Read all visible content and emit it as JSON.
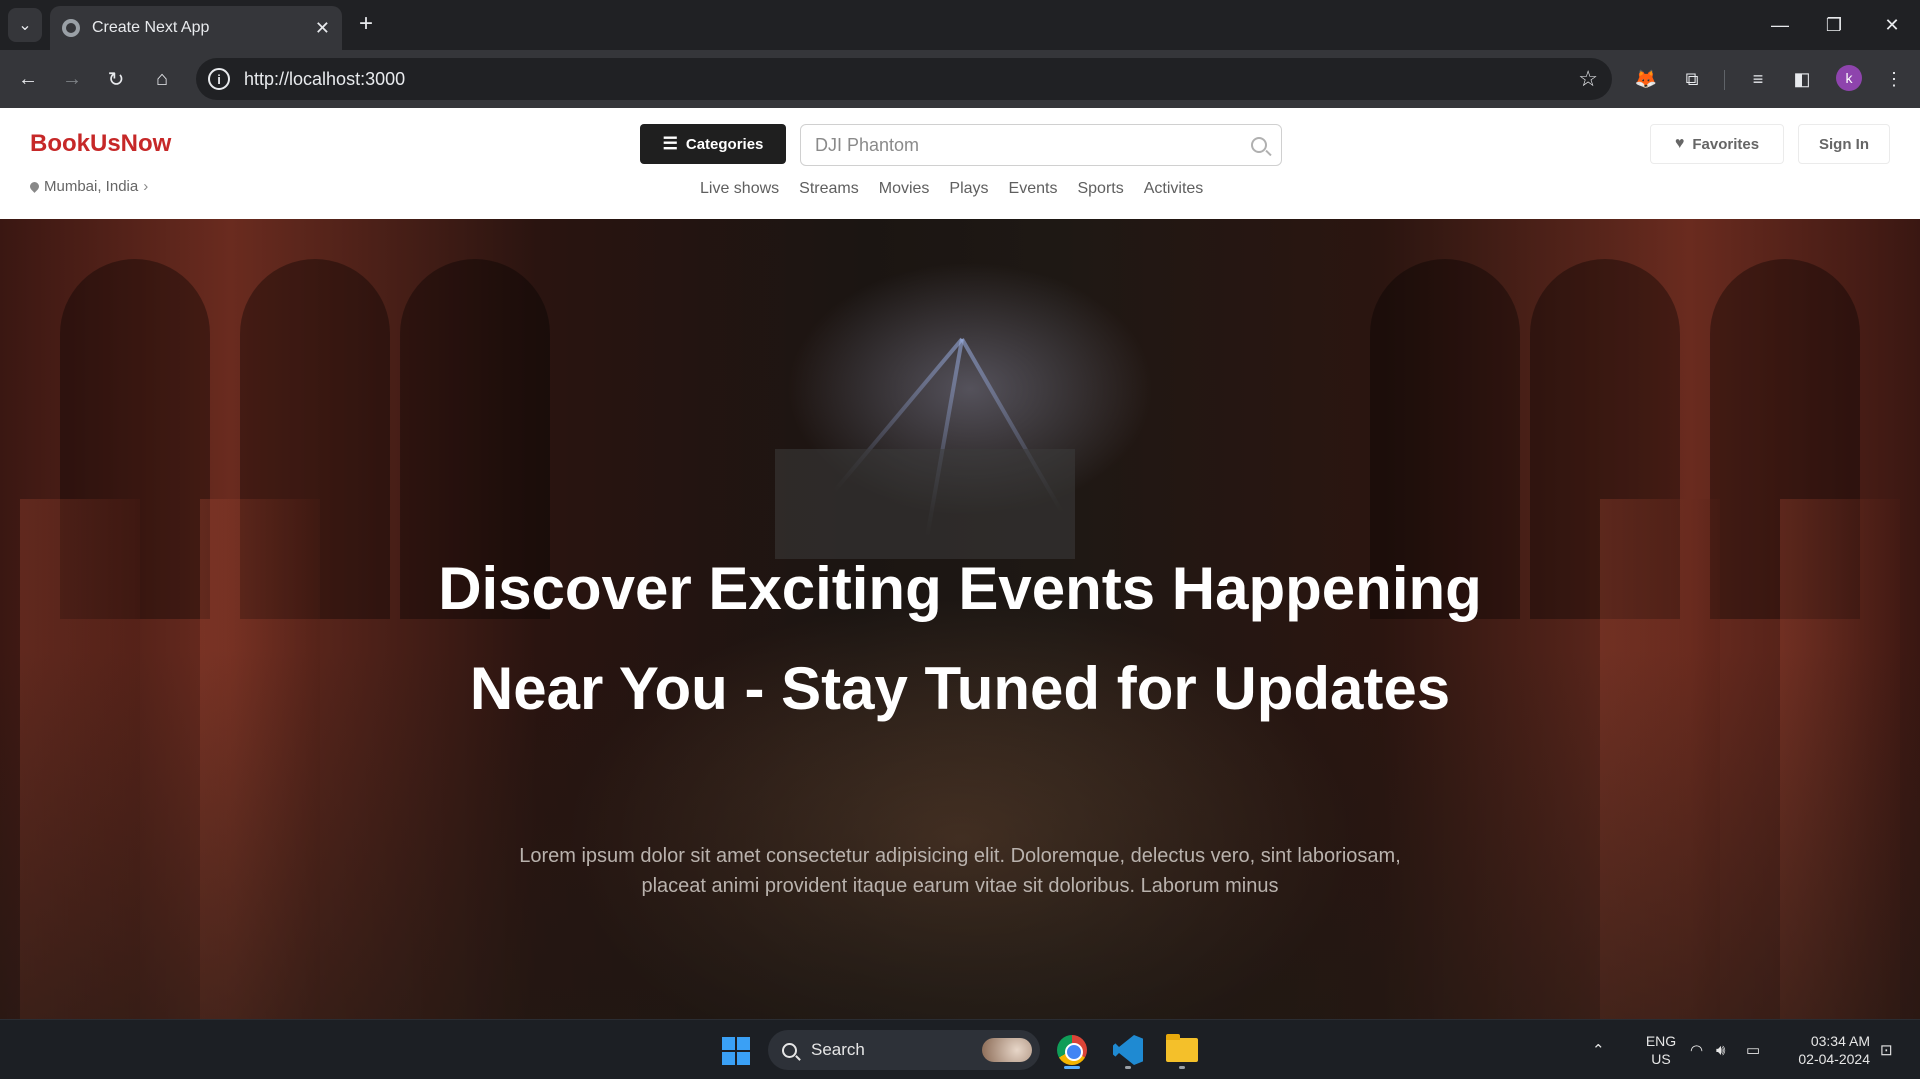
{
  "browser": {
    "tab_title": "Create Next App",
    "url": "http://localhost:3000",
    "profile_initial": "k"
  },
  "site": {
    "brand": "BookUsNow",
    "location": "Mumbai, India",
    "categories_label": "Categories",
    "search_placeholder": "DJI Phantom",
    "nav_links": [
      "Live shows",
      "Streams",
      "Movies",
      "Plays",
      "Events",
      "Sports",
      "Activites"
    ],
    "favorites_label": "Favorites",
    "signin_label": "Sign In"
  },
  "hero": {
    "title_line1": "Discover Exciting Events Happening",
    "title_line2": "Near You - Stay Tuned for Updates",
    "subtitle": "Lorem ipsum dolor sit amet consectetur adipisicing elit. Doloremque, delectus vero, sint laboriosam, placeat animi provident itaque earum vitae sit doloribus. Laborum minus"
  },
  "taskbar": {
    "search_label": "Search",
    "language": "ENG",
    "region": "US",
    "time": "03:34 AM",
    "date": "02-04-2024"
  },
  "colors": {
    "brand_red": "#c62828",
    "categories_bg": "#1f1f1f",
    "chrome_dark": "#202124",
    "taskbar": "#1c1f24"
  }
}
